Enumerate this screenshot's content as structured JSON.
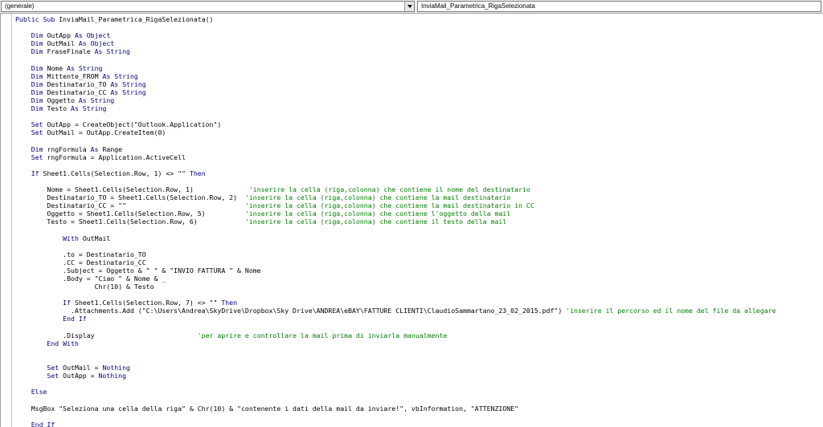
{
  "toolbar": {
    "object_combo": "(generale)",
    "procedure_combo": "InviaMail_Parametrica_RigaSelezionata"
  },
  "code_lines": [
    [
      {
        "t": "Public Sub ",
        "c": "kw"
      },
      {
        "t": "InviaMail_Parametrica_RigaSelezionata()",
        "c": "tx"
      }
    ],
    [],
    [
      {
        "t": "    Dim ",
        "c": "kw"
      },
      {
        "t": "OutApp ",
        "c": "tx"
      },
      {
        "t": "As Object",
        "c": "kw"
      }
    ],
    [
      {
        "t": "    Dim ",
        "c": "kw"
      },
      {
        "t": "OutMail ",
        "c": "tx"
      },
      {
        "t": "As Object",
        "c": "kw"
      }
    ],
    [
      {
        "t": "    Dim ",
        "c": "kw"
      },
      {
        "t": "FraseFinale ",
        "c": "tx"
      },
      {
        "t": "As String",
        "c": "kw"
      }
    ],
    [],
    [
      {
        "t": "    Dim ",
        "c": "kw"
      },
      {
        "t": "Nome ",
        "c": "tx"
      },
      {
        "t": "As String",
        "c": "kw"
      }
    ],
    [
      {
        "t": "    Dim ",
        "c": "kw"
      },
      {
        "t": "Mittente_FROM ",
        "c": "tx"
      },
      {
        "t": "As String",
        "c": "kw"
      }
    ],
    [
      {
        "t": "    Dim ",
        "c": "kw"
      },
      {
        "t": "Destinatario_TO ",
        "c": "tx"
      },
      {
        "t": "As String",
        "c": "kw"
      }
    ],
    [
      {
        "t": "    Dim ",
        "c": "kw"
      },
      {
        "t": "Destinatario_CC ",
        "c": "tx"
      },
      {
        "t": "As String",
        "c": "kw"
      }
    ],
    [
      {
        "t": "    Dim ",
        "c": "kw"
      },
      {
        "t": "Oggetto ",
        "c": "tx"
      },
      {
        "t": "As String",
        "c": "kw"
      }
    ],
    [
      {
        "t": "    Dim ",
        "c": "kw"
      },
      {
        "t": "Testo ",
        "c": "tx"
      },
      {
        "t": "As String",
        "c": "kw"
      }
    ],
    [],
    [
      {
        "t": "    Set ",
        "c": "kw"
      },
      {
        "t": "OutApp = CreateObject(\"Outlook.Application\")",
        "c": "tx"
      }
    ],
    [
      {
        "t": "    Set ",
        "c": "kw"
      },
      {
        "t": "OutMail = OutApp.CreateItem(0)",
        "c": "tx"
      }
    ],
    [],
    [
      {
        "t": "    Dim ",
        "c": "kw"
      },
      {
        "t": "rngFormula ",
        "c": "tx"
      },
      {
        "t": "As ",
        "c": "kw"
      },
      {
        "t": "Range",
        "c": "tx"
      }
    ],
    [
      {
        "t": "    Set ",
        "c": "kw"
      },
      {
        "t": "rngFormula = Application.ActiveCell",
        "c": "tx"
      }
    ],
    [],
    [
      {
        "t": "    If ",
        "c": "kw"
      },
      {
        "t": "Sheet1.Cells(Selection.Row, 1) <> \"\" ",
        "c": "tx"
      },
      {
        "t": "Then",
        "c": "kw"
      }
    ],
    [],
    [
      {
        "t": "        Nome = Sheet1.Cells(Selection.Row, 1)              ",
        "c": "tx"
      },
      {
        "t": "'inserire la cella (riga,colonna) che contiene il nome del destinatario",
        "c": "cm"
      }
    ],
    [
      {
        "t": "        Destinatario_TO = Sheet1.Cells(Selection.Row, 2)  ",
        "c": "tx"
      },
      {
        "t": "'inserire la cella (riga,colonna) che contiene la mail destinatario",
        "c": "cm"
      }
    ],
    [
      {
        "t": "        Destinatario_CC = \"\"                              ",
        "c": "tx"
      },
      {
        "t": "'inserire la cella (riga,colonna) che contiene la mail destinatario in CC",
        "c": "cm"
      }
    ],
    [
      {
        "t": "        Oggetto = Sheet1.Cells(Selection.Row, 5)          ",
        "c": "tx"
      },
      {
        "t": "'inserire la cella (riga,colonna) che contiene l'oggetto della mail",
        "c": "cm"
      }
    ],
    [
      {
        "t": "        Testo = Sheet1.Cells(Selection.Row, 6)            ",
        "c": "tx"
      },
      {
        "t": "'inserire la cella (riga,colonna) che contiene il testo della mail",
        "c": "cm"
      }
    ],
    [],
    [
      {
        "t": "            With ",
        "c": "kw"
      },
      {
        "t": "OutMail",
        "c": "tx"
      }
    ],
    [],
    [
      {
        "t": "            .to = Destinatario_TO",
        "c": "tx"
      }
    ],
    [
      {
        "t": "            .CC = Destinatario_CC",
        "c": "tx"
      }
    ],
    [
      {
        "t": "            .Subject = Oggetto & \" \" & \"INVIO FATTURA \" & Nome",
        "c": "tx"
      }
    ],
    [
      {
        "t": "            .Body = \"Ciao \" & Nome & _",
        "c": "tx"
      }
    ],
    [
      {
        "t": "                    Chr(10) & Testo",
        "c": "tx"
      }
    ],
    [],
    [
      {
        "t": "            If ",
        "c": "kw"
      },
      {
        "t": "Sheet1.Cells(Selection.Row, 7) <> \"\" ",
        "c": "tx"
      },
      {
        "t": "Then",
        "c": "kw"
      }
    ],
    [
      {
        "t": "              .Attachments.Add (\"C:\\Users\\Andrea\\SkyDrive\\Dropbox\\Sky Drive\\ANDREA\\eBAY\\FATTURE CLIENTI\\ClaudioSammartano_23_02_2015.pdf\") ",
        "c": "tx"
      },
      {
        "t": "'inserire il percorso ed il nome del file da allegare",
        "c": "cm"
      }
    ],
    [
      {
        "t": "            End If",
        "c": "kw"
      }
    ],
    [],
    [
      {
        "t": "            .Display                          ",
        "c": "tx"
      },
      {
        "t": "'per aprire e controllare la mail prima di inviarla manualmente",
        "c": "cm"
      }
    ],
    [
      {
        "t": "        End With",
        "c": "kw"
      }
    ],
    [],
    [],
    [
      {
        "t": "        Set ",
        "c": "kw"
      },
      {
        "t": "OutMail = ",
        "c": "tx"
      },
      {
        "t": "Nothing",
        "c": "kw"
      }
    ],
    [
      {
        "t": "        Set ",
        "c": "kw"
      },
      {
        "t": "OutApp = ",
        "c": "tx"
      },
      {
        "t": "Nothing",
        "c": "kw"
      }
    ],
    [],
    [
      {
        "t": "    Else",
        "c": "kw"
      }
    ],
    [],
    [
      {
        "t": "    MsgBox \"Seleziona una cella della riga\" & Chr(10) & \"contenente i dati della mail da inviare!\", vbInformation, \"ATTENZIONE\"",
        "c": "tx"
      }
    ],
    [],
    [
      {
        "t": "    End If",
        "c": "kw"
      }
    ]
  ]
}
